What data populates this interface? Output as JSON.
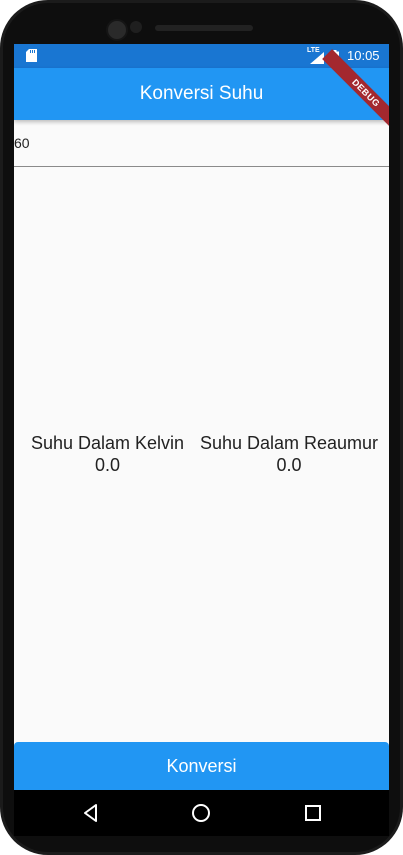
{
  "status_bar": {
    "network": "LTE",
    "time": "10:05",
    "icons": [
      "sd-card-icon",
      "signal-icon",
      "battery-icon"
    ]
  },
  "app_bar": {
    "title": "Konversi Suhu",
    "debug_banner": "DEBUG"
  },
  "input": {
    "value": "60"
  },
  "results": {
    "kelvin": {
      "label": "Suhu Dalam Kelvin",
      "value": "0.0"
    },
    "reaumur": {
      "label": "Suhu Dalam Reaumur",
      "value": "0.0"
    }
  },
  "convert_button": {
    "label": "Konversi"
  },
  "colors": {
    "primary": "#2196f3",
    "status_bar": "#1976d2",
    "background": "#fafafa",
    "debug_banner": "#a3282f"
  },
  "nav_bar": {
    "icons": [
      "back-icon",
      "home-icon",
      "recent-apps-icon"
    ]
  }
}
